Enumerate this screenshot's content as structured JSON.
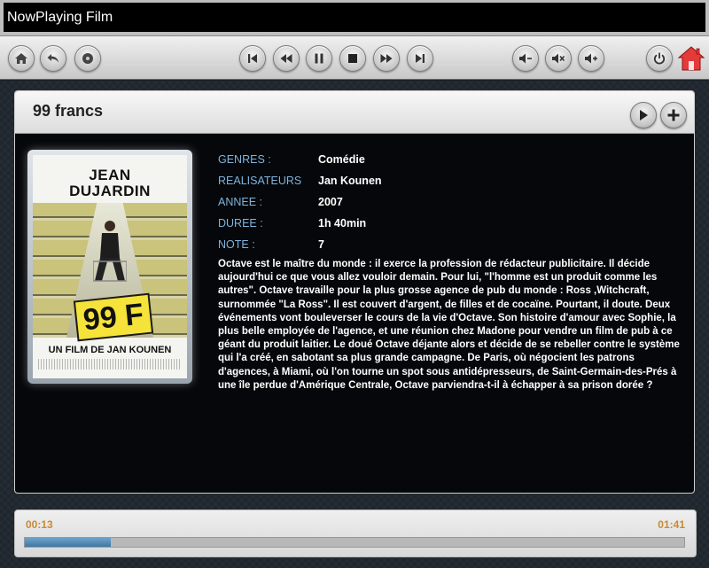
{
  "window": {
    "title": "NowPlaying Film"
  },
  "toolbar": {
    "left_icons": [
      "home-icon",
      "back-icon",
      "disc-icon"
    ],
    "transport_icons": [
      "skip-previous-icon",
      "rewind-icon",
      "pause-icon",
      "stop-icon",
      "fast-forward-icon",
      "skip-next-icon"
    ],
    "volume_icons": [
      "volume-down-icon",
      "mute-icon",
      "volume-up-icon"
    ],
    "right_icons": [
      "power-icon",
      "red-home-icon"
    ],
    "accent_red": "#e43a3a"
  },
  "film": {
    "title": "99 francs",
    "header_actions": [
      "play-icon",
      "add-icon"
    ],
    "poster": {
      "actor_top": "UN FILM DE",
      "actor_name_1": "JEAN",
      "actor_name_2": "DUJARDIN",
      "badge": "99 F",
      "director": "UN FILM DE JAN KOUNEN"
    },
    "details": [
      {
        "label": "GENRES :",
        "value": "Comédie"
      },
      {
        "label": "REALISATEURS",
        "value": "Jan Kounen"
      },
      {
        "label": "ANNEE :",
        "value": "2007"
      },
      {
        "label": "DUREE :",
        "value": "1h 40min"
      },
      {
        "label": "NOTE :",
        "value": "7"
      }
    ],
    "synopsis": "Octave est le maître du monde : il exerce la profession de rédacteur publicitaire. Il décide aujourd'hui ce que vous allez vouloir demain. Pour lui, \"l'homme est un produit comme les autres\". Octave travaille pour la plus grosse agence de pub du monde : Ross ,Witchcraft, surnommée \"La Ross\". Il est couvert d'argent, de filles et de cocaïne. Pourtant, il doute. Deux événements vont bouleverser le cours de la vie d'Octave. Son histoire d'amour avec Sophie, la plus belle employée de l'agence, et une réunion chez Madone pour vendre un film de pub à ce géant du produit laitier. Le doué Octave déjante alors et décide de se rebeller contre le système qui l'a créé, en sabotant sa plus grande campagne. De Paris, où négocient les patrons d'agences, à Miami, où l'on tourne un spot sous antidépresseurs, de Saint-Germain-des-Prés à une île perdue d'Amérique Centrale, Octave parviendra-t-il à échapper à sa prison dorée ?"
  },
  "player": {
    "current_time": "00:13",
    "total_time": "01:41",
    "progress_fraction": 0.13,
    "time_color": "#c98a33",
    "progress_color": "#4f86b1"
  }
}
